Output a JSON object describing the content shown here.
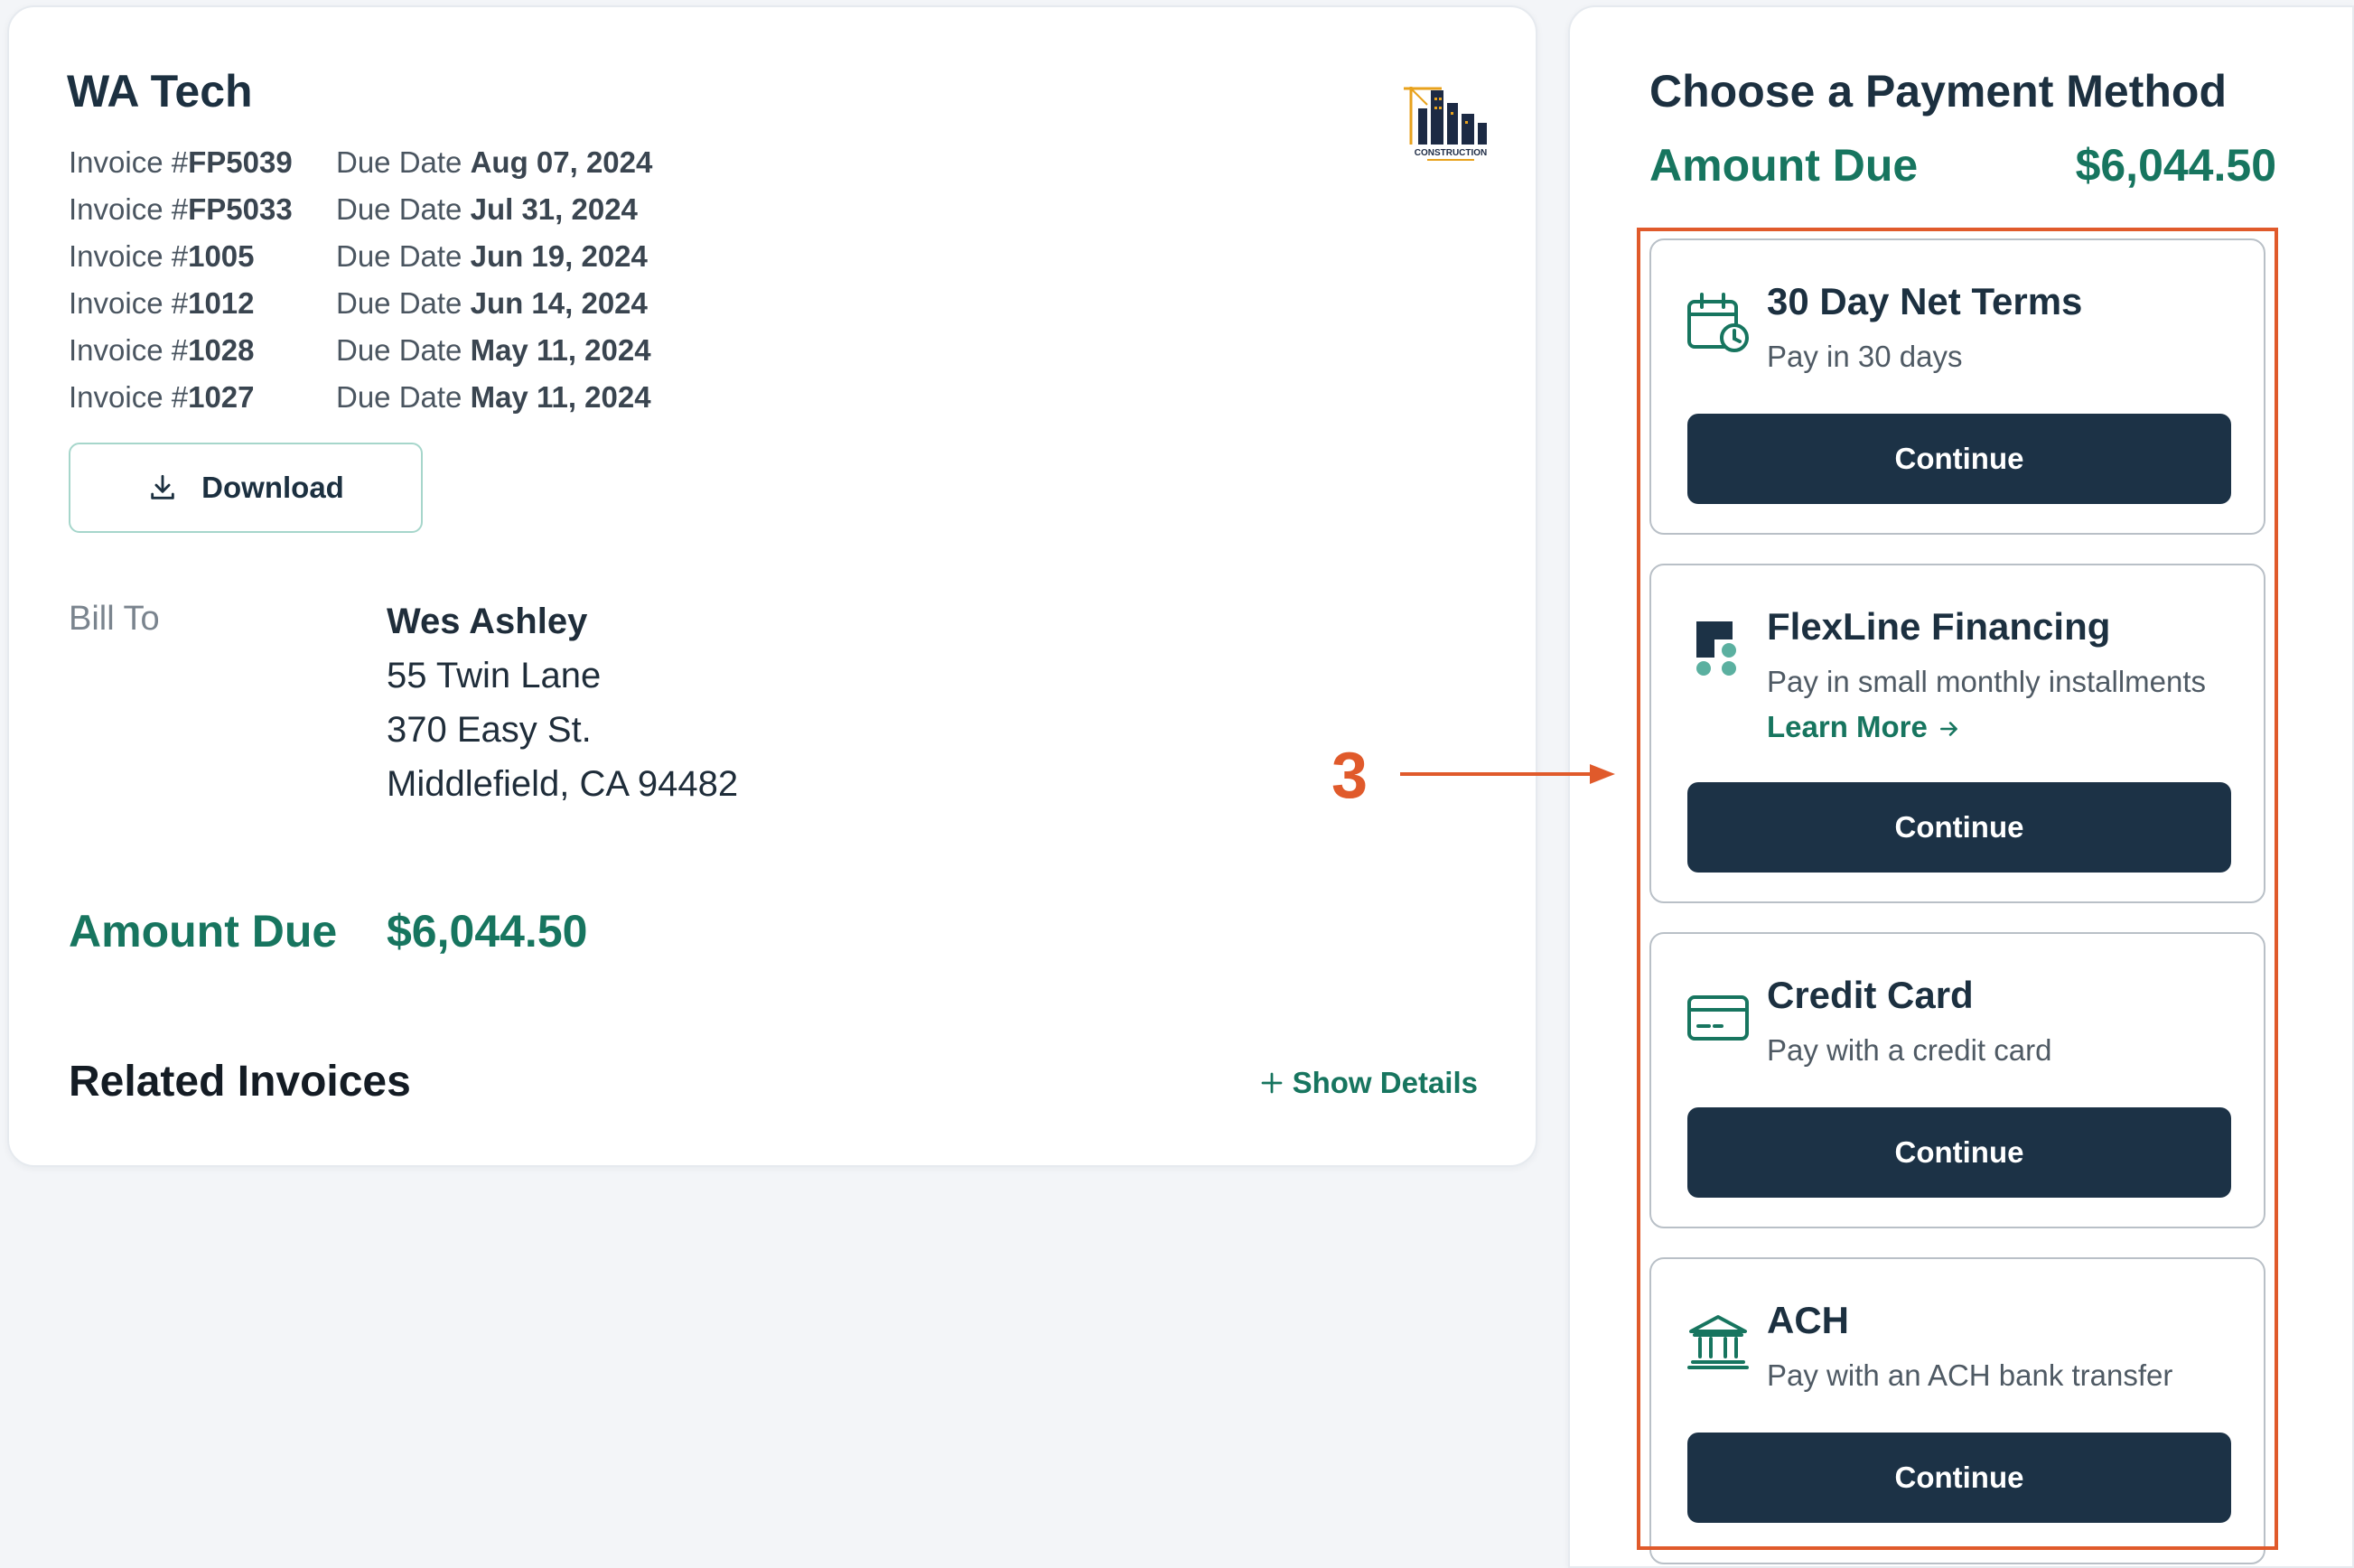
{
  "invoice": {
    "company": "WA Tech",
    "logo_text": "CONSTRUCTION",
    "rows": [
      {
        "prefix": "Invoice #",
        "number": "FP5039",
        "due_label": "Due Date ",
        "due": "Aug 07, 2024"
      },
      {
        "prefix": "Invoice #",
        "number": "FP5033",
        "due_label": "Due Date ",
        "due": "Jul 31, 2024"
      },
      {
        "prefix": "Invoice #",
        "number": "1005",
        "due_label": "Due Date ",
        "due": "Jun 19, 2024"
      },
      {
        "prefix": "Invoice #",
        "number": "1012",
        "due_label": "Due Date ",
        "due": "Jun 14, 2024"
      },
      {
        "prefix": "Invoice #",
        "number": "1028",
        "due_label": "Due Date ",
        "due": "May 11, 2024"
      },
      {
        "prefix": "Invoice #",
        "number": "1027",
        "due_label": "Due Date ",
        "due": "May 11, 2024"
      }
    ],
    "download_label": "Download",
    "bill_to_label": "Bill To",
    "bill_to": {
      "name": "Wes Ashley",
      "line1": "55 Twin Lane",
      "line2": "370 Easy St.",
      "line3": "Middlefield, CA 94482"
    },
    "amount_due_label": "Amount Due",
    "amount_due": "$6,044.50",
    "related_title": "Related Invoices",
    "show_details": "Show Details"
  },
  "payment": {
    "title": "Choose a Payment Method",
    "amount_due_label": "Amount Due",
    "amount_due": "$6,044.50",
    "methods": [
      {
        "title": "30 Day Net Terms",
        "subtitle": "Pay in 30 days",
        "button": "Continue",
        "icon": "calendar-clock-icon"
      },
      {
        "title": "FlexLine Financing",
        "subtitle": "Pay in small monthly installments",
        "link": "Learn More",
        "button": "Continue",
        "icon": "flexline-logo-icon"
      },
      {
        "title": "Credit Card",
        "subtitle": "Pay with a credit card",
        "button": "Continue",
        "icon": "credit-card-icon"
      },
      {
        "title": "ACH",
        "subtitle": "Pay with an ACH bank transfer",
        "button": "Continue",
        "icon": "bank-icon"
      }
    ]
  },
  "annotation": {
    "number": "3"
  },
  "colors": {
    "brand_green": "#17755f",
    "navy": "#1c3246",
    "annotation": "#e05a2b"
  }
}
